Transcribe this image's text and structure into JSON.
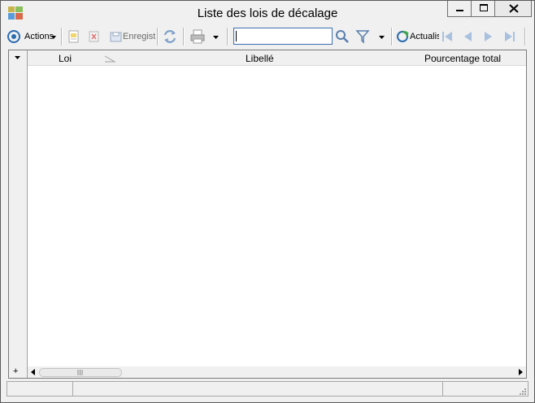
{
  "window": {
    "title": "Liste des lois de décalage",
    "icon": "app-grid-icon"
  },
  "toolbar": {
    "actions_label": "Actions",
    "save_label": "Enregist",
    "refresh_label": "Actualis",
    "search": {
      "value": "",
      "placeholder": ""
    }
  },
  "grid": {
    "columns": [
      "Loi",
      "Libellé",
      "Pourcentage total"
    ],
    "sort_column": "Loi",
    "rows": []
  },
  "colors": {
    "accent": "#2b6cb0",
    "close_hover": "#e81123"
  }
}
